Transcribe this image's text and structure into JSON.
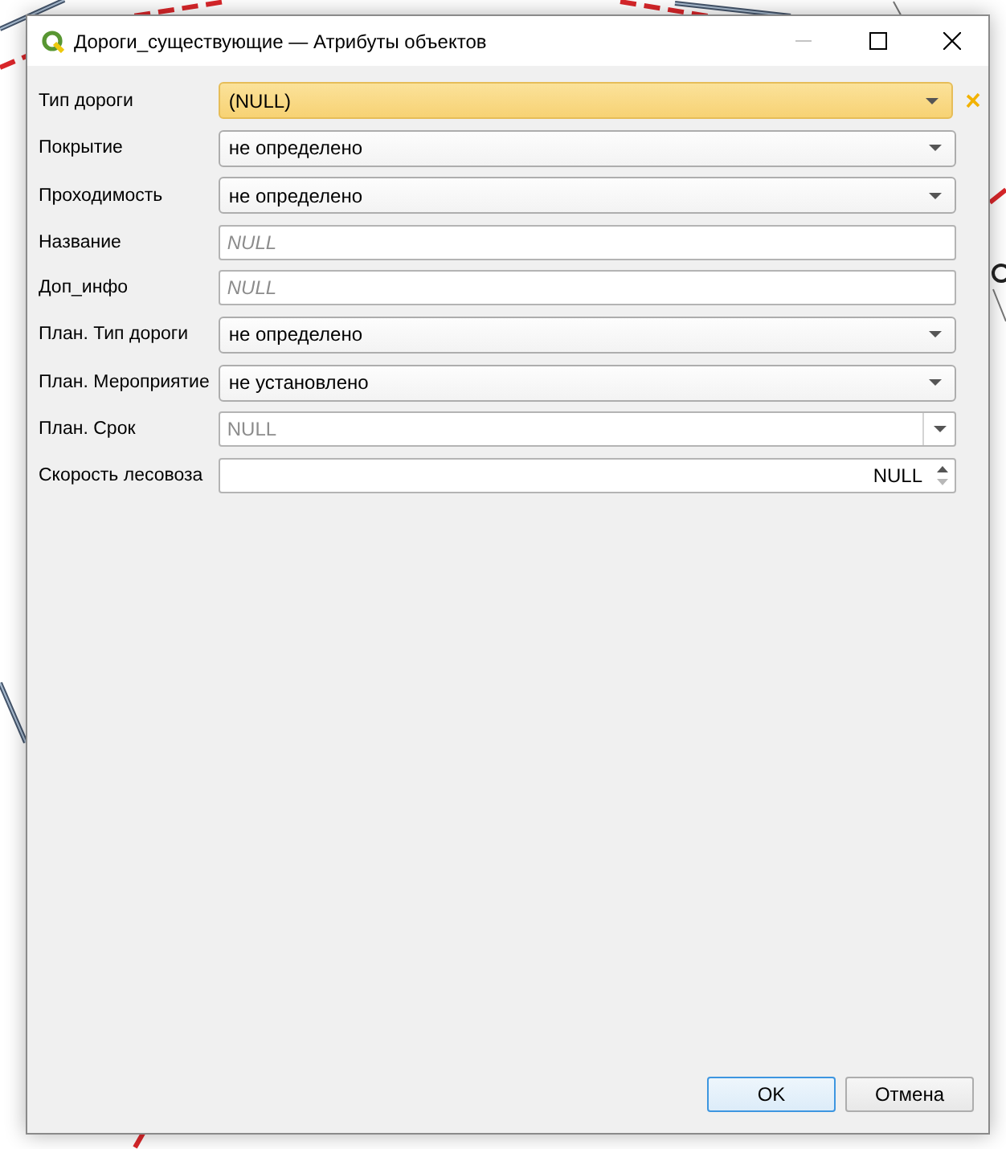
{
  "window": {
    "title": "Дороги_существующие — Атрибуты объектов",
    "minimize_enabled": false
  },
  "fields": [
    {
      "label": "Тип дороги",
      "kind": "combo",
      "value": "(NULL)",
      "warning": true
    },
    {
      "label": "Покрытие",
      "kind": "combo",
      "value": "не определено",
      "warning": false
    },
    {
      "label": "Проходимость",
      "kind": "combo",
      "value": "не определено",
      "warning": false
    },
    {
      "label": "Название",
      "kind": "text",
      "placeholder": "NULL",
      "warning": false
    },
    {
      "label": "Доп_инфо",
      "kind": "text",
      "placeholder": "NULL",
      "warning": false
    },
    {
      "label": "План. Тип дороги",
      "kind": "combo",
      "value": "не определено",
      "warning": false
    },
    {
      "label": "План. Мероприятие",
      "kind": "combo",
      "value": "не установлено",
      "warning": false
    },
    {
      "label": "План. Срок",
      "kind": "date",
      "placeholder": "NULL",
      "warning": false
    },
    {
      "label": "Скорость лесовоза",
      "kind": "spin",
      "value": "NULL",
      "warning": false
    }
  ],
  "buttons": [
    {
      "label": "OK",
      "default": true
    },
    {
      "label": "Отмена",
      "default": false
    }
  ]
}
